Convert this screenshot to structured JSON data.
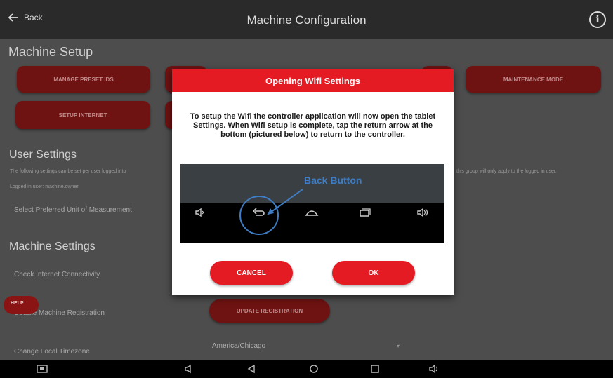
{
  "header": {
    "back_label": "Back",
    "title": "Machine Configuration",
    "info_icon": "info-icon",
    "info_glyph": "i"
  },
  "machine_setup": {
    "heading": "Machine Setup",
    "buttons": [
      "MANAGE PRESET IDS",
      "MAINTENANCE MODE",
      "SETUP INTERNET"
    ]
  },
  "user_settings": {
    "heading": "User Settings",
    "description_left_1": "The following settings can be set per user logged into",
    "description_left_2": "Logged in user: machine.owner",
    "description_right": "this group will only apply to the logged in user.",
    "unit_label": "Select Preferred Unit of Measurement"
  },
  "machine_settings": {
    "heading": "Machine Settings",
    "connectivity_label": "Check Internet Connectivity",
    "registration_label": "Update Machine Registration",
    "registration_button": "UPDATE REGISTRATION",
    "timezone_label": "Change Local Timezone",
    "timezone_value": "America/Chicago",
    "help_label": "HELP"
  },
  "modal": {
    "title": "Opening Wifi Settings",
    "message": "To setup the Wifi the controller application will now open the tablet Settings. When Wifi setup is complete, tap the return arrow at the bottom (pictured below) to return to the controller.",
    "callout": "Back Button",
    "cancel_label": "CANCEL",
    "ok_label": "OK"
  },
  "colors": {
    "accent": "#e41b23",
    "callout": "#3f7dc4",
    "dim_background": "#4d4d4d"
  }
}
